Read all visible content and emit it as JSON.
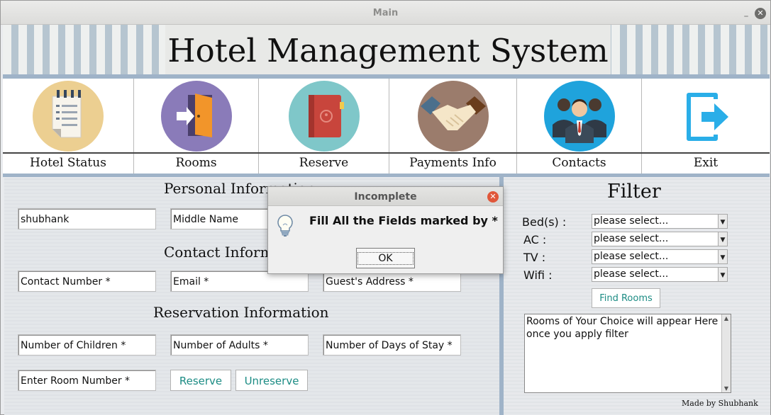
{
  "window": {
    "title": "Main",
    "min_glyph": "_",
    "close_glyph": "✕"
  },
  "header": {
    "title": "Hotel Management System"
  },
  "nav": {
    "items": [
      {
        "label": "Hotel Status",
        "icon": "notepad-icon"
      },
      {
        "label": "Rooms",
        "icon": "door-enter-icon"
      },
      {
        "label": "Reserve",
        "icon": "book-icon"
      },
      {
        "label": "Payments Info",
        "icon": "handshake-icon"
      },
      {
        "label": "Contacts",
        "icon": "people-icon"
      },
      {
        "label": "Exit",
        "icon": "exit-icon"
      }
    ]
  },
  "form": {
    "personal_title": "Personal Information",
    "contact_title": "Contact Information",
    "reservation_title": "Reservation Information",
    "first_name": "shubhank",
    "middle_name": "Middle Name",
    "contact_number": "Contact Number *",
    "email": "Email *",
    "guest_address": "Guest's Address *",
    "children": "Number of Children *",
    "adults": "Number of Adults *",
    "days": "Number of Days of Stay *",
    "room_number": "Enter Room Number *",
    "reserve_label": "Reserve",
    "unreserve_label": "Unreserve"
  },
  "filter": {
    "title": "Filter",
    "beds_label": "Bed(s) :",
    "ac_label": "AC :",
    "tv_label": "TV :",
    "wifi_label": "Wifi :",
    "beds_value": "please select...",
    "ac_value": "please select...",
    "tv_value": "please select...",
    "wifi_value": "please select...",
    "find_label": "Find Rooms",
    "result_text": "Rooms of Your Choice will appear Here once you apply filter",
    "made_by": "Made by Shubhank"
  },
  "dialog": {
    "title": "Incomplete",
    "message": "Fill All the Fields marked by *",
    "ok_label": "OK",
    "close_glyph": "✕"
  },
  "colors": {
    "accent": "#1c8c84",
    "separator": "#9fb3c8",
    "hotel_status_circle": "#eccf91",
    "rooms_circle": "#8a7bb9",
    "reserve_circle": "#7fc7c9",
    "payments_circle": "#9b7c6c",
    "contacts_circle": "#1fa3dc",
    "exit_icon": "#2aaee8"
  }
}
